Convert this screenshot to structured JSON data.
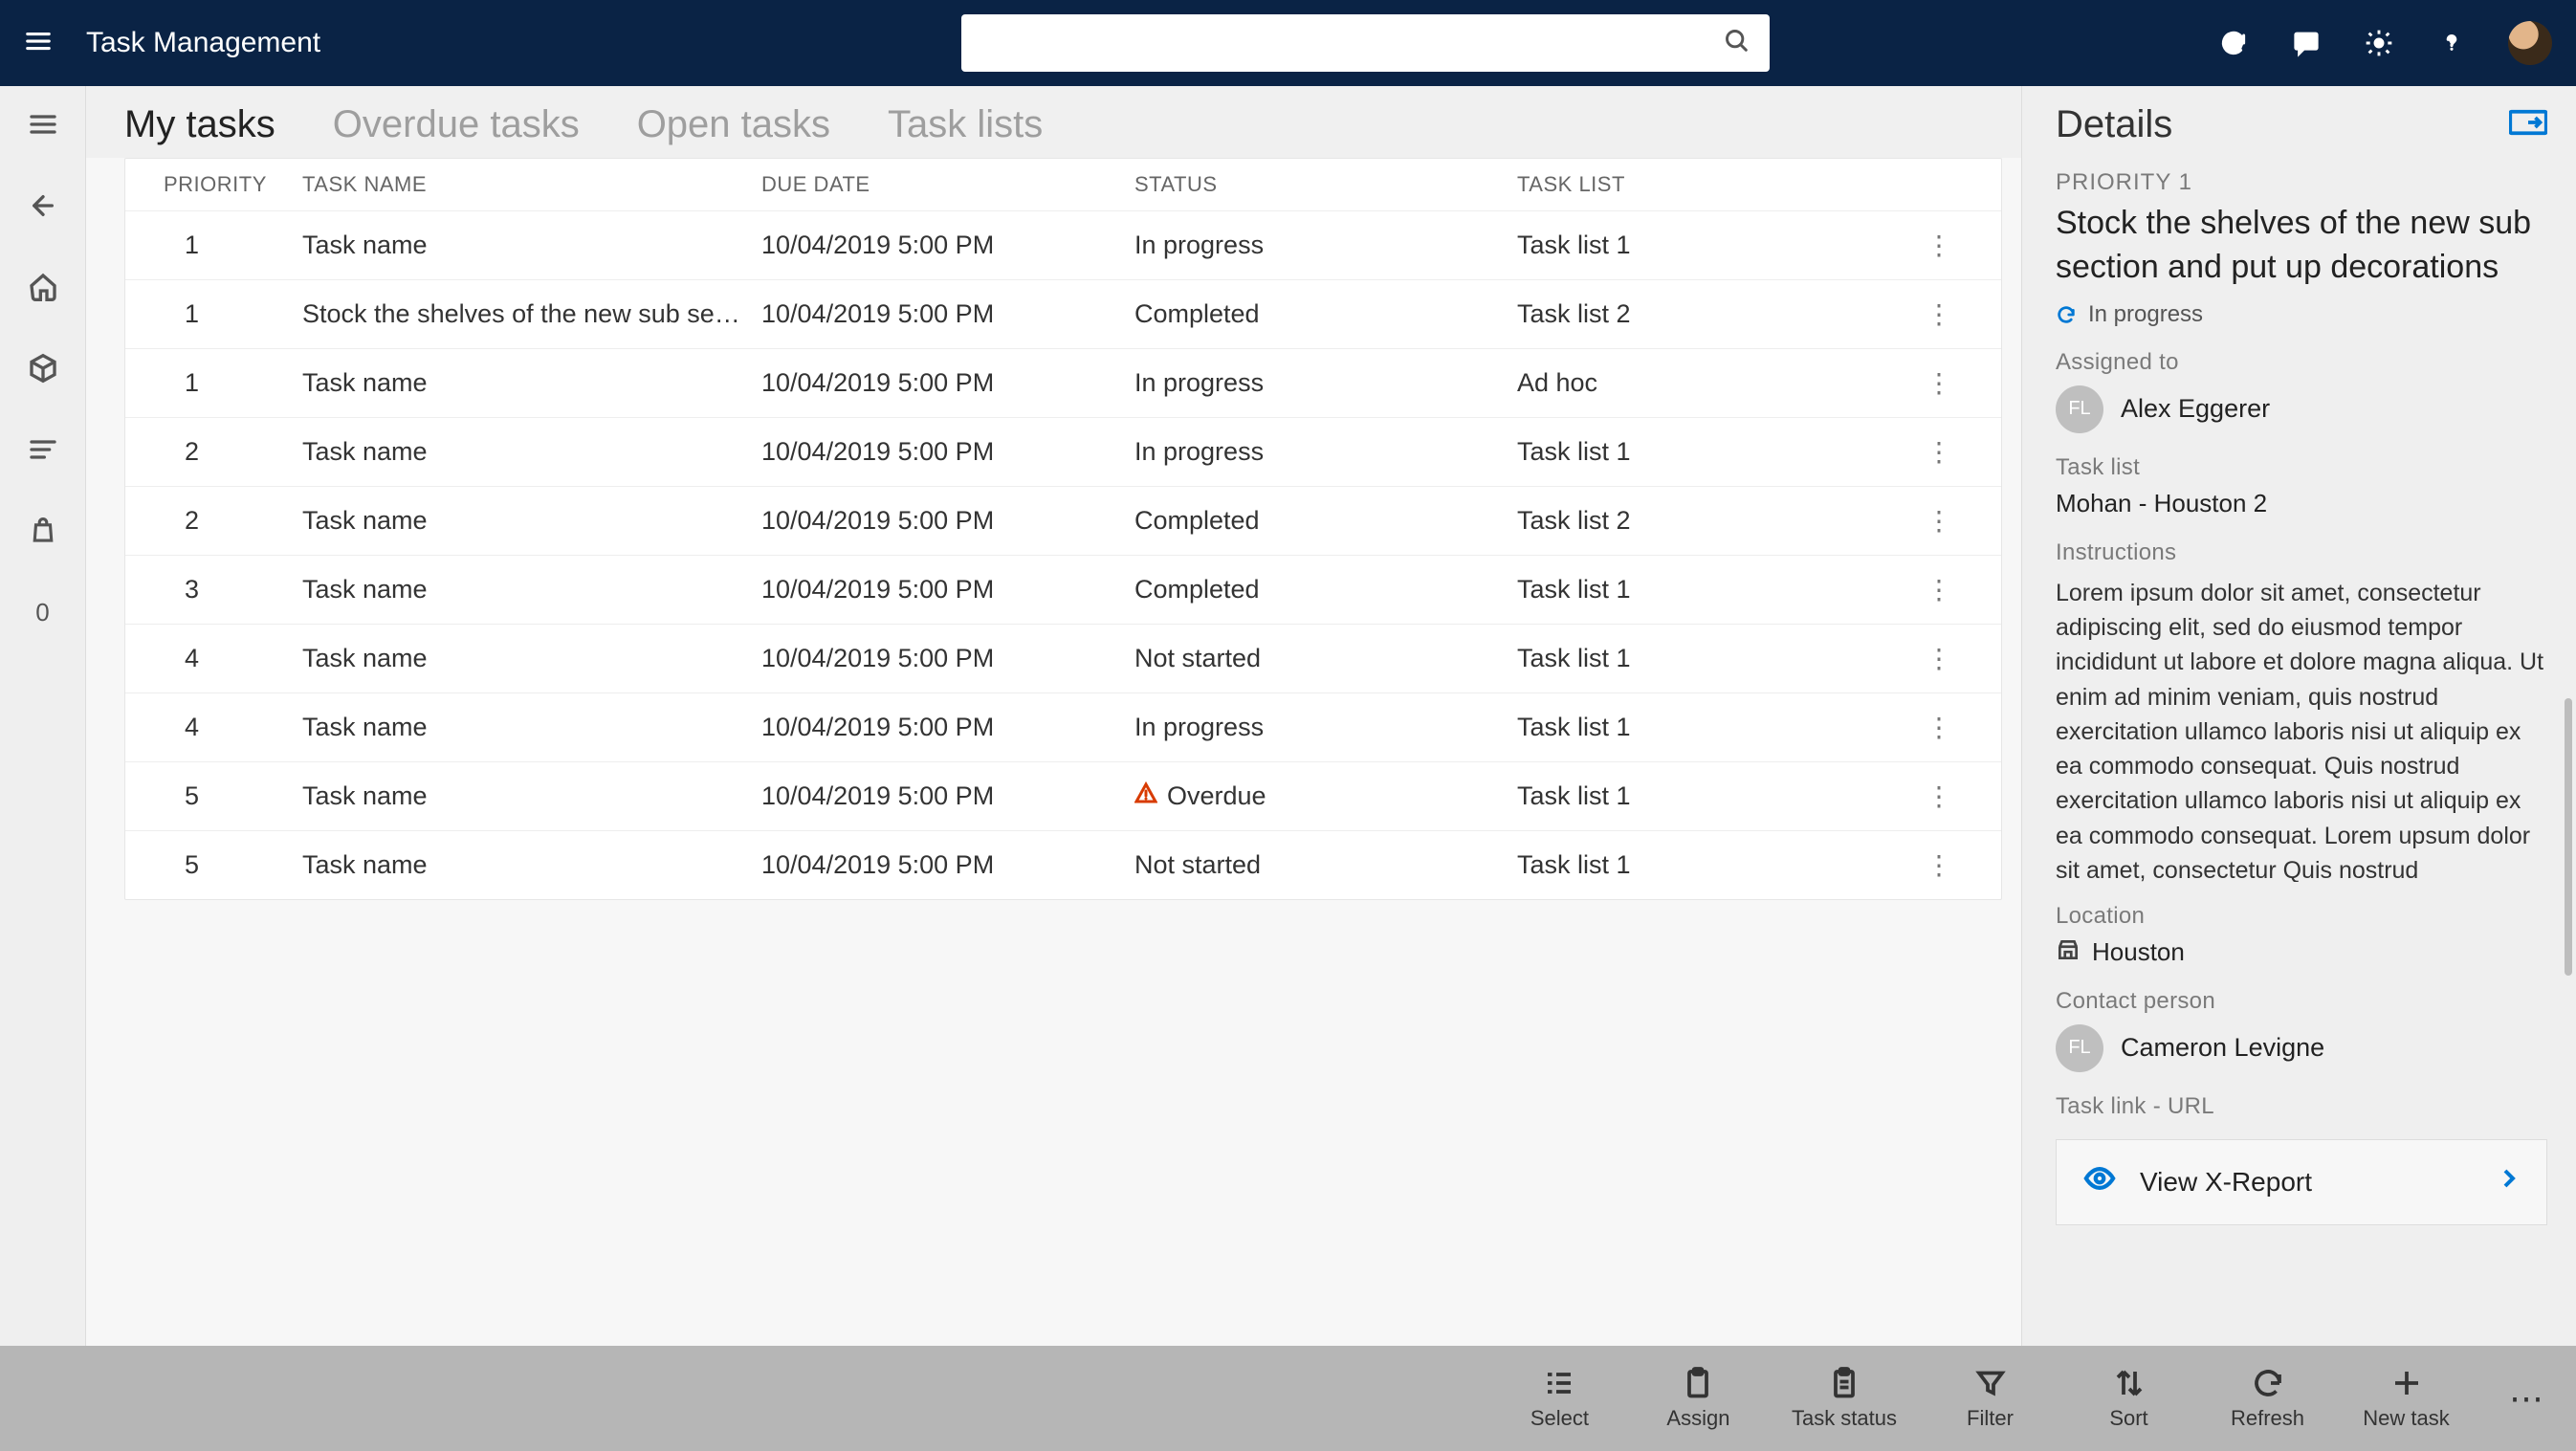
{
  "app_title": "Task Management",
  "search_placeholder": "",
  "tabs": [
    "My tasks",
    "Overdue tasks",
    "Open tasks",
    "Task lists"
  ],
  "active_tab_index": 0,
  "columns": {
    "priority": "PRIORITY",
    "name": "TASK NAME",
    "due": "DUE DATE",
    "status": "STATUS",
    "list": "TASK LIST"
  },
  "rows": [
    {
      "priority": "1",
      "name": "Task name",
      "due": "10/04/2019 5:00 PM",
      "status": "In progress",
      "list": "Task list 1",
      "overdue": false
    },
    {
      "priority": "1",
      "name": "Stock the shelves of the new sub section…",
      "due": "10/04/2019 5:00 PM",
      "status": "Completed",
      "list": "Task list 2",
      "overdue": false
    },
    {
      "priority": "1",
      "name": "Task name",
      "due": "10/04/2019 5:00 PM",
      "status": "In progress",
      "list": "Ad hoc",
      "overdue": false
    },
    {
      "priority": "2",
      "name": "Task name",
      "due": "10/04/2019 5:00 PM",
      "status": "In progress",
      "list": "Task list 1",
      "overdue": false
    },
    {
      "priority": "2",
      "name": "Task name",
      "due": "10/04/2019 5:00 PM",
      "status": "Completed",
      "list": "Task list 2",
      "overdue": false
    },
    {
      "priority": "3",
      "name": "Task name",
      "due": "10/04/2019 5:00 PM",
      "status": "Completed",
      "list": "Task list 1",
      "overdue": false
    },
    {
      "priority": "4",
      "name": "Task name",
      "due": "10/04/2019 5:00 PM",
      "status": "Not started",
      "list": "Task list 1",
      "overdue": false
    },
    {
      "priority": "4",
      "name": "Task name",
      "due": "10/04/2019 5:00 PM",
      "status": "In progress",
      "list": "Task list 1",
      "overdue": false
    },
    {
      "priority": "5",
      "name": "Task name",
      "due": "10/04/2019 5:00 PM",
      "status": "Overdue",
      "list": "Task list 1",
      "overdue": true
    },
    {
      "priority": "5",
      "name": "Task name",
      "due": "10/04/2019 5:00 PM",
      "status": "Not started",
      "list": "Task list 1",
      "overdue": false
    }
  ],
  "details": {
    "header": "Details",
    "priority_label": "PRIORITY 1",
    "task_title": "Stock the shelves of the new sub section and put up decorations",
    "status": "In progress",
    "assigned_to_label": "Assigned to",
    "assigned_to_name": "Alex Eggerer",
    "assigned_to_initials": "FL",
    "task_list_label": "Task list",
    "task_list_value": "Mohan - Houston 2",
    "instructions_label": "Instructions",
    "instructions_text": "Lorem ipsum dolor sit amet, consectetur adipiscing elit, sed do eiusmod tempor incididunt ut labore et dolore magna aliqua. Ut enim ad minim veniam, quis nostrud exercitation ullamco laboris nisi ut aliquip ex ea commodo consequat. Quis nostrud exercitation ullamco laboris nisi ut aliquip ex ea commodo consequat. Lorem upsum dolor sit amet, consectetur Quis nostrud exercitation ullamco laboris nisi ut",
    "location_label": "Location",
    "location_value": "Houston",
    "contact_label": "Contact person",
    "contact_name": "Cameron Levigne",
    "contact_initials": "FL",
    "task_link_label": "Task link - URL",
    "task_link_text": "View X-Report"
  },
  "bottom_actions": {
    "select": "Select",
    "assign": "Assign",
    "task_status": "Task status",
    "filter": "Filter",
    "sort": "Sort",
    "refresh": "Refresh",
    "new_task": "New task"
  },
  "leftrail_badge": "0"
}
